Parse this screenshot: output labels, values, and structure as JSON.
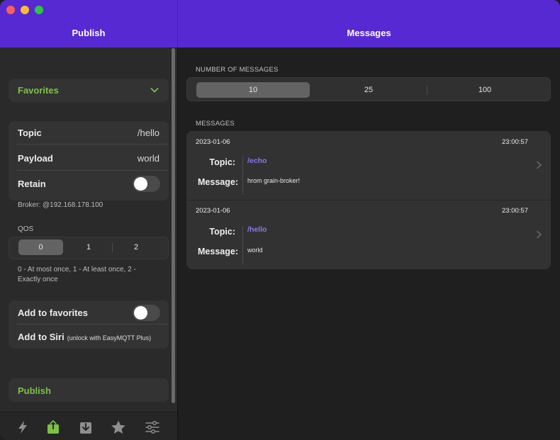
{
  "window": {
    "left_title": "Publish",
    "right_title": "Messages"
  },
  "publish": {
    "favorites_label": "Favorites",
    "topic_label": "Topic",
    "topic_value": "/hello",
    "payload_label": "Payload",
    "payload_value": "world",
    "retain_label": "Retain",
    "retain_on": false,
    "broker_text": "Broker: @192.168.178.100",
    "qos_label": "QOS",
    "qos_options": [
      "0",
      "1",
      "2"
    ],
    "qos_selected": "0",
    "qos_help_line1": "0 - At most once, 1 - At least once, 2 -",
    "qos_help_line2": "Exactly once",
    "add_fav_label": "Add to favorites",
    "add_fav_on": false,
    "siri_label": "Add to Siri",
    "siri_note": "(unlock with EasyMQTT Plus)",
    "publish_button": "Publish"
  },
  "tabs": [
    {
      "name": "connect",
      "icon": "bolt-icon",
      "active": false
    },
    {
      "name": "publish",
      "icon": "share-icon",
      "active": true
    },
    {
      "name": "subscribe",
      "icon": "download-icon",
      "active": false
    },
    {
      "name": "favorites",
      "icon": "star-icon",
      "active": false
    },
    {
      "name": "settings",
      "icon": "sliders-icon",
      "active": false
    }
  ],
  "messages_pane": {
    "count_label": "NUMBER OF MESSAGES",
    "count_options": [
      "10",
      "25",
      "100"
    ],
    "count_selected": "10",
    "messages_label": "MESSAGES",
    "topic_key": "Topic:",
    "message_key": "Message:",
    "messages": [
      {
        "date": "2023-01-06",
        "time": "23:00:57",
        "topic": "/echo",
        "message": "hrom grain-broker!"
      },
      {
        "date": "2023-01-06",
        "time": "23:00:57",
        "topic": "/hello",
        "message": "world"
      }
    ]
  },
  "colors": {
    "header": "#5729d3",
    "accent_green": "#7cc246",
    "topic_purple": "#8b78ee"
  }
}
